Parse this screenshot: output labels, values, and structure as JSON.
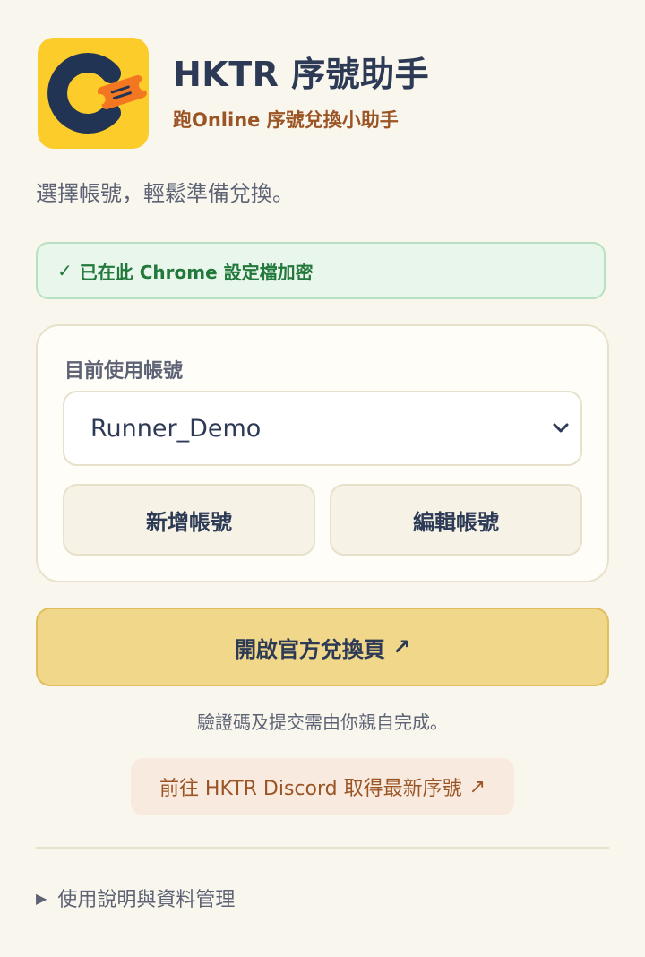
{
  "header": {
    "title": "HKTR 序號助手",
    "subtitle": "跑Online 序號兌換小助手",
    "logo_icon": "ticket-c-logo"
  },
  "intro": "選擇帳號，輕鬆準備兌換。",
  "status": {
    "check": "✓",
    "text": "已在此 Chrome 設定檔加密"
  },
  "account": {
    "label": "目前使用帳號",
    "selected": "Runner_Demo",
    "add_label": "新增帳號",
    "edit_label": "編輯帳號"
  },
  "actions": {
    "open_label": "開啟官方兌換頁",
    "external_icon": "↗",
    "note": "驗證碼及提交需由你親自完成。",
    "discord_label": "前往 HKTR Discord 取得最新序號"
  },
  "details": {
    "toggle": "▶",
    "label": "使用說明與資料管理"
  },
  "colors": {
    "background": "#f9f6ee",
    "logo_bg": "#fccd2a",
    "primary_text": "#2c3a55",
    "accent_brown": "#9b5424",
    "success_green": "#23783c",
    "main_button": "#f1d78a"
  }
}
